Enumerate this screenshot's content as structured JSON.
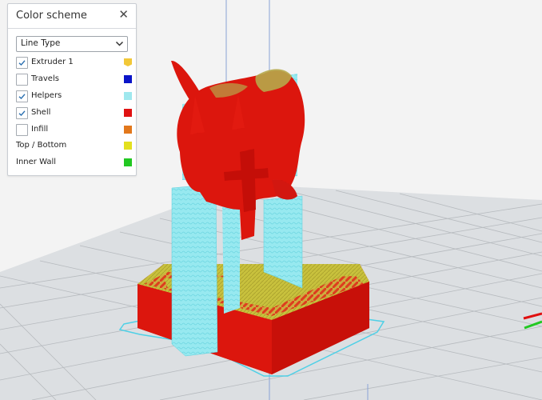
{
  "panel": {
    "title": "Color scheme",
    "close_icon": "close-icon",
    "dropdown": {
      "value": "Line Type"
    },
    "items": [
      {
        "label": "Extruder 1",
        "checkbox": true,
        "checked": true,
        "color": "#f2c838",
        "swatch_shape": "flag"
      },
      {
        "label": "Travels",
        "checkbox": true,
        "checked": false,
        "color": "#0a14c8"
      },
      {
        "label": "Helpers",
        "checkbox": true,
        "checked": true,
        "color": "#9fe8ee"
      },
      {
        "label": "Shell",
        "checkbox": true,
        "checked": true,
        "color": "#e01212"
      },
      {
        "label": "Infill",
        "checkbox": true,
        "checked": false,
        "color": "#e2781c"
      },
      {
        "label": "Top / Bottom",
        "checkbox": false,
        "color": "#e3e01e"
      },
      {
        "label": "Inner Wall",
        "checkbox": false,
        "color": "#22c822"
      }
    ]
  },
  "colors": {
    "shell": "#e21a10",
    "helpers": "#8fe6ef",
    "topbottom": "#c9c23a",
    "build_plate_grid": "#b9bcc0",
    "outline": "#4fd0e6"
  }
}
